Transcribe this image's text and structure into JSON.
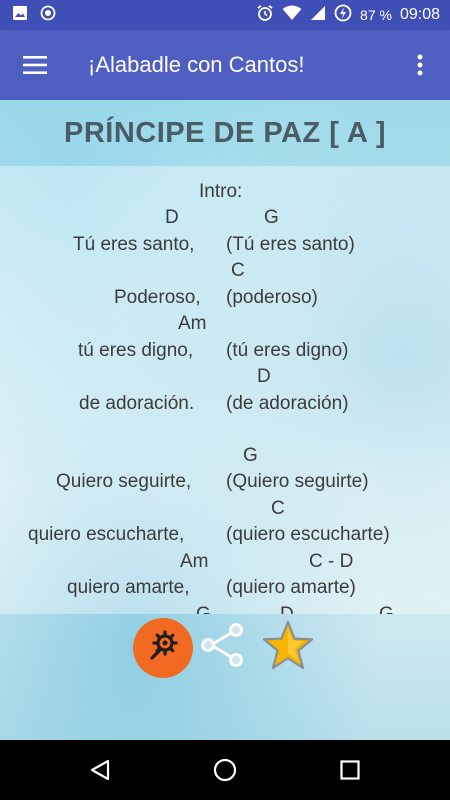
{
  "status_bar": {
    "battery_percent": "87 %",
    "time": "09:08",
    "icons": [
      "image-icon",
      "record-icon",
      "alarm-icon",
      "wifi-icon",
      "signal-icon",
      "battery-charging-icon"
    ]
  },
  "app_bar": {
    "title": "¡Alabadle con Cantos!",
    "menu_icon": "hamburger-menu-icon",
    "more_icon": "more-vert-icon"
  },
  "song": {
    "title": "PRÍNCIPE DE PAZ [ A ]",
    "lines": [
      "Intro:",
      "D",
      "G",
      "Tú eres santo,",
      "(Tú eres santo)",
      "C",
      "Poderoso,",
      "(poderoso)",
      "Am",
      "tú eres digno,",
      "(tú eres digno)",
      "D",
      "de adoración.",
      "(de adoración)",
      "G",
      "Quiero seguirte,",
      "(Quiero seguirte)",
      "C",
      "quiero escucharte,",
      "(quiero escucharte)",
      "Am",
      "C - D",
      "quiero amarte,",
      "(quiero amarte)",
      "G",
      "D",
      "-",
      "G"
    ]
  },
  "actions": {
    "settings_icon": "wrench-gear-icon",
    "share_icon": "share-icon",
    "favorite_icon": "star-icon",
    "accent_color": "#f26a21",
    "star_color": "#f7b500"
  },
  "colors": {
    "status_bar": "#3f4fb5",
    "app_bar": "#4f5ec1",
    "title_text": "#4a5c66",
    "lyrics_text": "#3c3c3c"
  },
  "nav_bar": {
    "icons": [
      "back-icon",
      "home-icon",
      "recent-apps-icon"
    ]
  }
}
